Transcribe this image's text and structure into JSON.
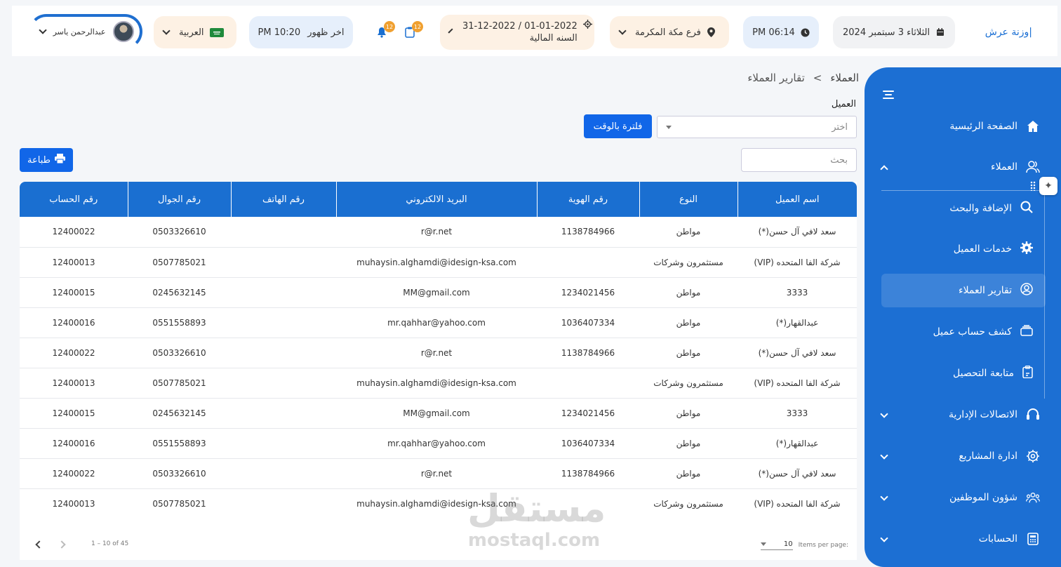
{
  "header": {
    "brand": "وزنة عرش|",
    "date": "الثلاثاء 3 سبتمبر 2024",
    "time": "PM 06:14",
    "branch": "فرع مكة المكرمة",
    "fiscal_range": "31-12-2022 / 01-01-2022",
    "fiscal_label": "السنه المالية",
    "notif_count_1": "12",
    "notif_count_2": "12",
    "prayer_label": "اخر ظهور",
    "prayer_time": "PM 10:20",
    "language": "العربية",
    "user_name": "عبدالرحمن ياسر"
  },
  "sidebar": {
    "home": "الصفحة الرئيسية",
    "customers": "العملاء",
    "sub": [
      "الإضافة والبحث",
      "خدمات العميل",
      "تقارير العملاء",
      "كشف حساب عميل",
      "متابعة التحصيل"
    ],
    "admin_comm": "الاتصالات الإدارية",
    "projects": "ادارة المشاريع",
    "hr": "شؤون الموظفين",
    "accounts": "الحسابات"
  },
  "breadcrumb": {
    "root": "العملاء",
    "sep": "<",
    "current": "تقارير العملاء"
  },
  "filter": {
    "label": "العميل",
    "select_placeholder": "اختر",
    "time_filter_button": "فلترة بالوقت",
    "search_placeholder": "بحث",
    "print_button": "طباعة"
  },
  "table": {
    "headers": [
      "اسم العميل",
      "النوع",
      "رقم الهوية",
      "البريد الالكتروني",
      "رقم الهاتف",
      "رقم الجوال",
      "رقم الحساب"
    ],
    "rows": [
      [
        "سعد لافي آل حسن(*)",
        "مواطن",
        "1138784966",
        "r@r.net",
        "",
        "0503326610",
        "12400022"
      ],
      [
        "شركة الفا المتحده (VIP)",
        "مستثمرون وشركات",
        "",
        "muhaysin.alghamdi@idesign-ksa.com",
        "",
        "0507785021",
        "12400013"
      ],
      [
        "3333",
        "مواطن",
        "1234021456",
        "MM@gmail.com",
        "",
        "0245632145",
        "12400015"
      ],
      [
        "عبدالقهار(*)",
        "مواطن",
        "1036407334",
        "mr.qahhar@yahoo.com",
        "",
        "0551558893",
        "12400016"
      ],
      [
        "سعد لافي آل حسن(*)",
        "مواطن",
        "1138784966",
        "r@r.net",
        "",
        "0503326610",
        "12400022"
      ],
      [
        "شركة الفا المتحده (VIP)",
        "مستثمرون وشركات",
        "",
        "muhaysin.alghamdi@idesign-ksa.com",
        "",
        "0507785021",
        "12400013"
      ],
      [
        "3333",
        "مواطن",
        "1234021456",
        "MM@gmail.com",
        "",
        "0245632145",
        "12400015"
      ],
      [
        "عبدالقهار(*)",
        "مواطن",
        "1036407334",
        "mr.qahhar@yahoo.com",
        "",
        "0551558893",
        "12400016"
      ],
      [
        "سعد لافي آل حسن(*)",
        "مواطن",
        "1138784966",
        "r@r.net",
        "",
        "0503326610",
        "12400022"
      ],
      [
        "شركة الفا المتحده (VIP)",
        "مستثمرون وشركات",
        "",
        "muhaysin.alghamdi@idesign-ksa.com",
        "",
        "0507785021",
        "12400013"
      ]
    ]
  },
  "pagination": {
    "range": "1 – 10 of 45",
    "per_page_label": "Items per page:",
    "per_page_value": "10"
  },
  "watermark": {
    "arabic": "مستقل",
    "latin": "mostaql.com"
  }
}
